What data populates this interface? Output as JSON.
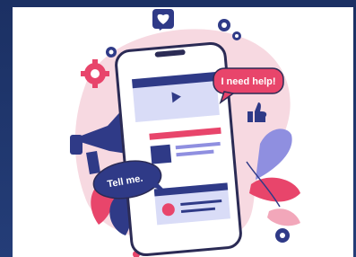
{
  "illustration": {
    "bubble_help": "I need help!",
    "bubble_tell": "Tell me.",
    "colors": {
      "navy": "#2f3a87",
      "pink": "#e8456b",
      "light_pink": "#f6d7df",
      "lavender": "#8f8fe0",
      "phone_border": "#2b2b55"
    },
    "icons": [
      "heart-icon",
      "gear-icon",
      "megaphone-icon",
      "thumbs-up-icon",
      "play-icon",
      "user-icon"
    ]
  }
}
